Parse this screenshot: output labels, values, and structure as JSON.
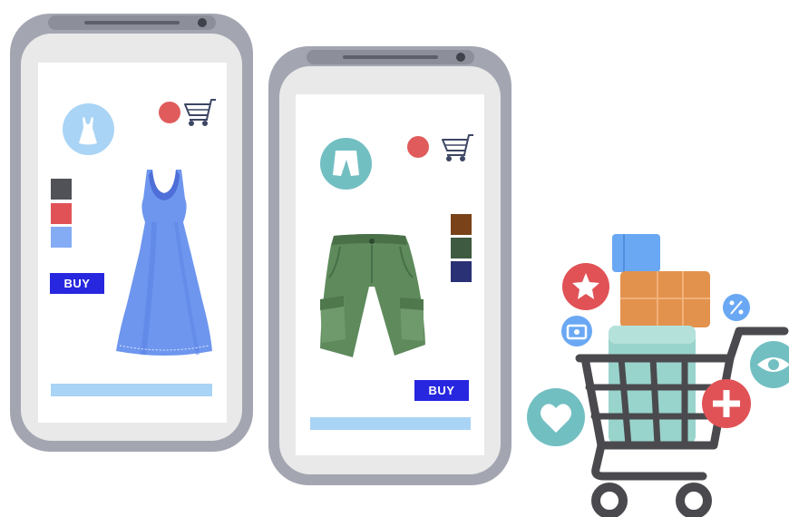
{
  "colors": {
    "phone_frame": "#a3a6b1",
    "button_blue": "#2727e0",
    "bar_light_blue": "#a9d4f5",
    "badge_red": "#e05c5c",
    "dress_blue": "#6e96ef",
    "shorts_green": "#5e8a5c",
    "teal": "#72bfc2"
  },
  "phone_left": {
    "category_icon": "dress-icon",
    "product": "dress",
    "swatches": [
      "#505258",
      "#e05256",
      "#84acf5"
    ],
    "buy_label": "BUY"
  },
  "phone_right": {
    "category_icon": "shorts-icon",
    "product": "cargo-shorts",
    "swatches": [
      "#7a4218",
      "#3e5a40",
      "#2a3175"
    ],
    "buy_label": "BUY"
  },
  "cart_illustration": {
    "icons": [
      "star-icon",
      "camera-icon",
      "heart-icon",
      "plus-icon",
      "eye-icon",
      "percent-icon"
    ]
  }
}
